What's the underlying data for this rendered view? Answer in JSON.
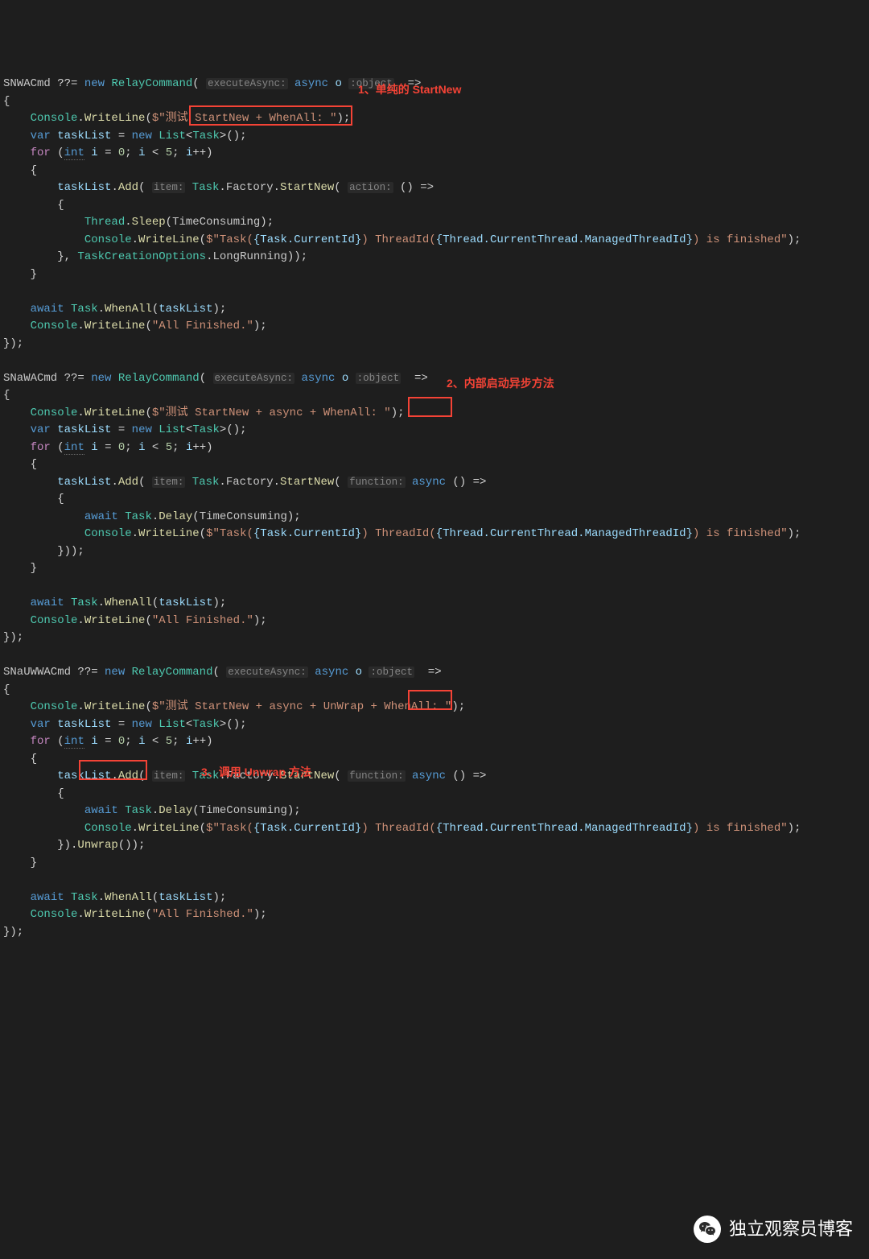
{
  "annotations": {
    "a1": "1、单纯的 StartNew",
    "a2": "2、内部启动异步方法",
    "a3": "3、调用 Unwrap 方法"
  },
  "watermark": "独立观察员博客",
  "code": {
    "block1": {
      "cmd": "SNWACmd",
      "eq": " ??= ",
      "new": "new",
      "relay": "RelayCommand",
      "hint1": "executeAsync:",
      "async": "async",
      "o": "o",
      "otype": ":object",
      "arrow": " =>",
      "lb": "{",
      "console": "Console",
      "wl": "WriteLine",
      "s1a": "$\"测试 StartNew + WhenAll: \"",
      "var": "var",
      "tl": "taskList",
      "list": "List",
      "task": "Task",
      "for": "for",
      "int": "int",
      "i": "i",
      "zero": "0",
      "five": "5",
      "add": "Add",
      "hintitem": "item:",
      "factory": "Factory",
      "startnew": "StartNew",
      "hintaction": "action:",
      "empty": "()",
      "thread": "Thread",
      "sleep": "Sleep",
      "tc": "TimeConsuming",
      "s2a": "$\"Task(",
      "s2b": "{Task.CurrentId}",
      "s2c": ") ThreadId(",
      "s2d": "{Thread.CurrentThread.ManagedThreadId}",
      "s2e": ") is finished\"",
      "tco": "TaskCreationOptions",
      "lr": "LongRunning",
      "await": "await",
      "whenall": "WhenAll",
      "allfin": "\"All Finished.\""
    },
    "block2": {
      "cmd": "SNaWACmd",
      "s1a": "$\"测试 StartNew + async + WhenAll: \"",
      "hintfunc": "function:",
      "delay": "Delay"
    },
    "block3": {
      "cmd": "SNaUWWACmd",
      "s1a": "$\"测试 StartNew + async + UnWrap + WhenAll: \"",
      "unwrap": "Unwrap"
    }
  }
}
